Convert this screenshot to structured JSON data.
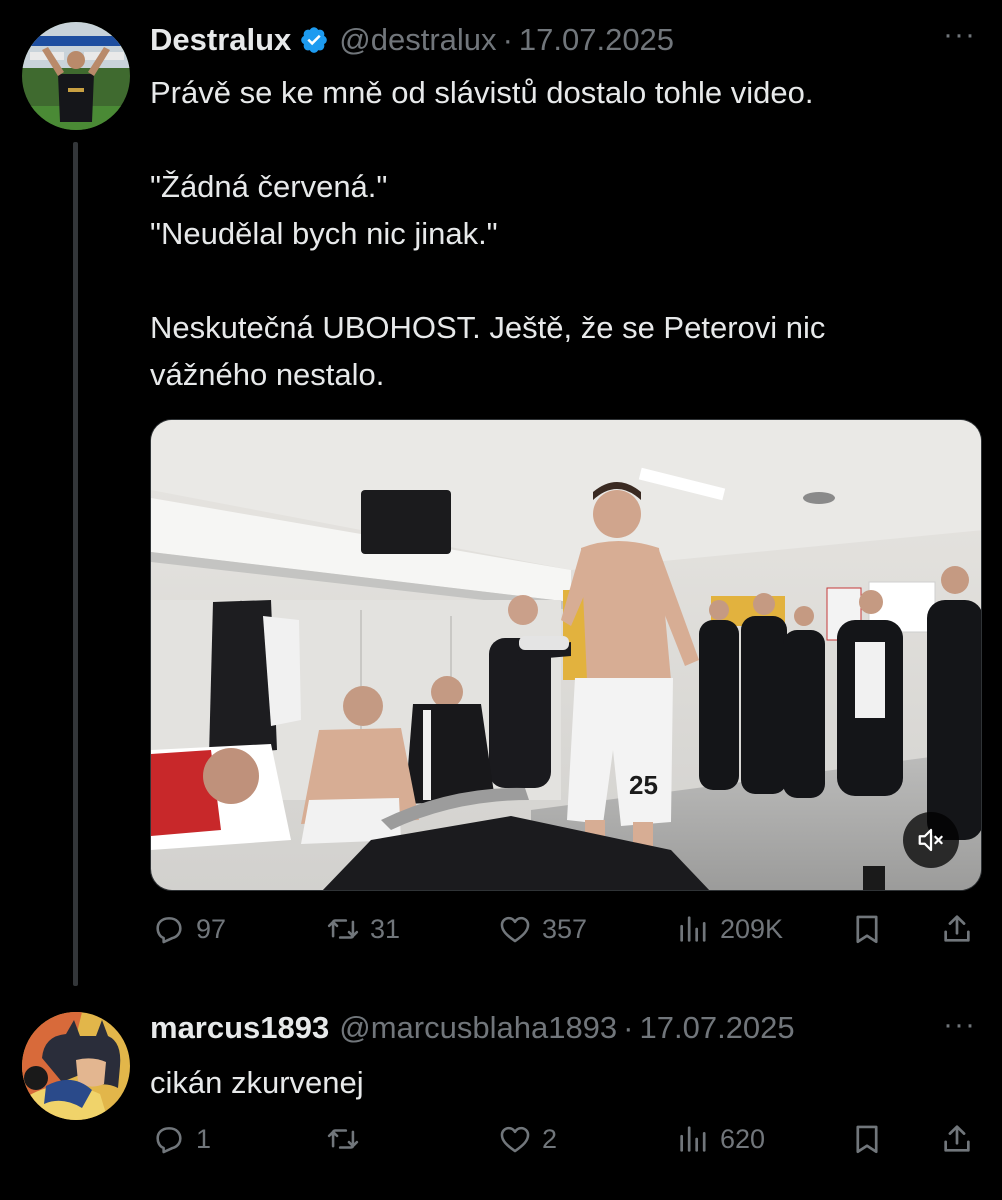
{
  "tweet": {
    "display_name": "Destralux",
    "handle": "@destralux",
    "separator": "·",
    "date": "17.07.2025",
    "more_label": "···",
    "text_lines": [
      "Právě se ke mně od slávistů dostalo tohle video.",
      "",
      "\"Žádná červená.\"",
      "\"Neudělal bych nic jinak.\"",
      "",
      "Neskutečná UBOHOST. Ještě, že se Peterovi nic",
      "vážného nestalo."
    ],
    "video": {
      "jersey_number": "25",
      "muted": true,
      "mute_icon": "speaker-muted-icon"
    },
    "actions": {
      "replies": "97",
      "reposts": "31",
      "likes": "357",
      "views": "209K"
    }
  },
  "reply": {
    "display_name": "marcus1893",
    "handle": "@marcusblaha1893",
    "separator": "·",
    "date": "17.07.2025",
    "more_label": "···",
    "text": "cikán zkurvenej",
    "actions": {
      "replies": "1",
      "reposts": "",
      "likes": "2",
      "views": "620"
    }
  },
  "colors": {
    "background": "#000000",
    "text": "#e7e9ea",
    "secondary": "#71767b",
    "verified": "#1d9bf0",
    "thread_line": "#333639"
  },
  "icons": [
    "reply-icon",
    "repost-icon",
    "like-icon",
    "views-icon",
    "bookmark-icon",
    "share-icon",
    "verified-badge-icon",
    "more-icon"
  ]
}
